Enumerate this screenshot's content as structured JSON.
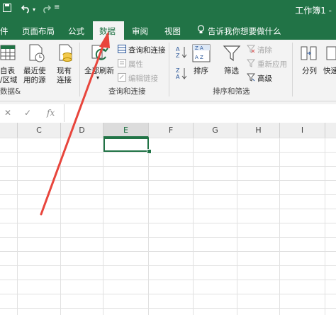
{
  "titlebar": {
    "title": "工作簿1 -",
    "icons": [
      "save-icon",
      "undo-icon",
      "redo-icon",
      "customize-qat-icon"
    ]
  },
  "tabs": [
    {
      "label": "文件",
      "visible_part": "件"
    },
    {
      "label": "页面布局"
    },
    {
      "label": "公式"
    },
    {
      "label": "数据",
      "selected": true
    },
    {
      "label": "审阅"
    },
    {
      "label": "视图"
    },
    {
      "label": "告诉我你想要做什么"
    }
  ],
  "ribbon": {
    "get_external": {
      "line1": "自表",
      "line2": "/区域",
      "icon": "from-table-icon"
    },
    "recent_sources": {
      "line1": "最近使",
      "line2": "用的源",
      "icon": "recent-sources-icon"
    },
    "existing_conn": {
      "line1": "现有",
      "line2": "连接",
      "icon": "existing-connections-icon"
    },
    "group_get_transform": "数据&",
    "refresh_all": {
      "line1": "全部刷新",
      "icon": "refresh-all-icon"
    },
    "queries_connections": "查询和连接",
    "properties": "属性",
    "edit_links": "编辑链接",
    "group_queries": "查询和连接",
    "sort": {
      "label": "排序",
      "icon": "sort-icon"
    },
    "filter": {
      "label": "筛选",
      "icon": "filter-icon"
    },
    "clear": "清除",
    "reapply": "重新应用",
    "advanced": "高级",
    "group_sort_filter": "排序和筛选",
    "text_to_columns": "分列",
    "flash_fill": "快速"
  },
  "formula_bar": {
    "cancel_symbol": "✕",
    "enter_symbol": "✓",
    "fx_symbol": "fx",
    "value": ""
  },
  "columns": [
    "C",
    "D",
    "E",
    "F",
    "G",
    "H",
    "I"
  ],
  "selected_column": "E",
  "accent": "#217346",
  "arrow_color": "#e8453c"
}
